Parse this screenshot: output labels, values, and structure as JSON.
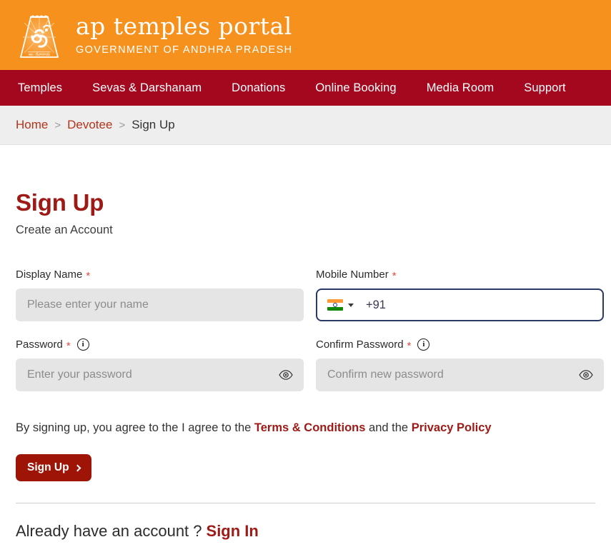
{
  "header": {
    "brand_title": "ap temples portal",
    "brand_subtitle": "GOVERNMENT OF ANDHRA PRADESH",
    "logo_icon": "temple-gopuram-om-icon",
    "bg_color": "#F7911E"
  },
  "nav": {
    "bg_color": "#A3081F",
    "items": [
      {
        "label": "Temples"
      },
      {
        "label": "Sevas & Darshanam"
      },
      {
        "label": "Donations"
      },
      {
        "label": "Online Booking"
      },
      {
        "label": "Media Room"
      },
      {
        "label": "Support"
      }
    ]
  },
  "breadcrumb": {
    "separator": ">",
    "items": [
      {
        "label": "Home",
        "current": false
      },
      {
        "label": "Devotee",
        "current": false
      },
      {
        "label": "Sign Up",
        "current": true
      }
    ]
  },
  "page": {
    "title": "Sign Up",
    "subtitle": "Create an Account",
    "title_color": "#9E1A16"
  },
  "form": {
    "display_name": {
      "label": "Display Name",
      "required_marker": "*",
      "placeholder": "Please enter your name",
      "value": ""
    },
    "mobile_number": {
      "label": "Mobile Number",
      "required_marker": "*",
      "country_flag": "india-flag-icon",
      "dial_code": "+91",
      "value": "",
      "focused": true,
      "focus_border_color": "#2A3A66"
    },
    "password": {
      "label": "Password",
      "required_marker": "*",
      "info_icon": "info-circle-icon",
      "placeholder": "Enter your password",
      "value": "",
      "toggle_icon": "eye-icon"
    },
    "confirm_password": {
      "label": "Confirm Password",
      "required_marker": "*",
      "info_icon": "info-circle-icon",
      "placeholder": "Confirm new password",
      "value": "",
      "toggle_icon": "eye-icon"
    }
  },
  "terms": {
    "prefix": "By signing up, you agree to the I agree to the",
    "terms_link": "Terms & Conditions",
    "middle": "and the",
    "privacy_link": "Privacy Policy"
  },
  "actions": {
    "signup_button": "Sign Up",
    "signup_button_color": "#9E1508",
    "chevron_icon": "chevron-right-icon"
  },
  "footer": {
    "already_text": "Already have an account ?",
    "signin_link": "Sign In"
  }
}
